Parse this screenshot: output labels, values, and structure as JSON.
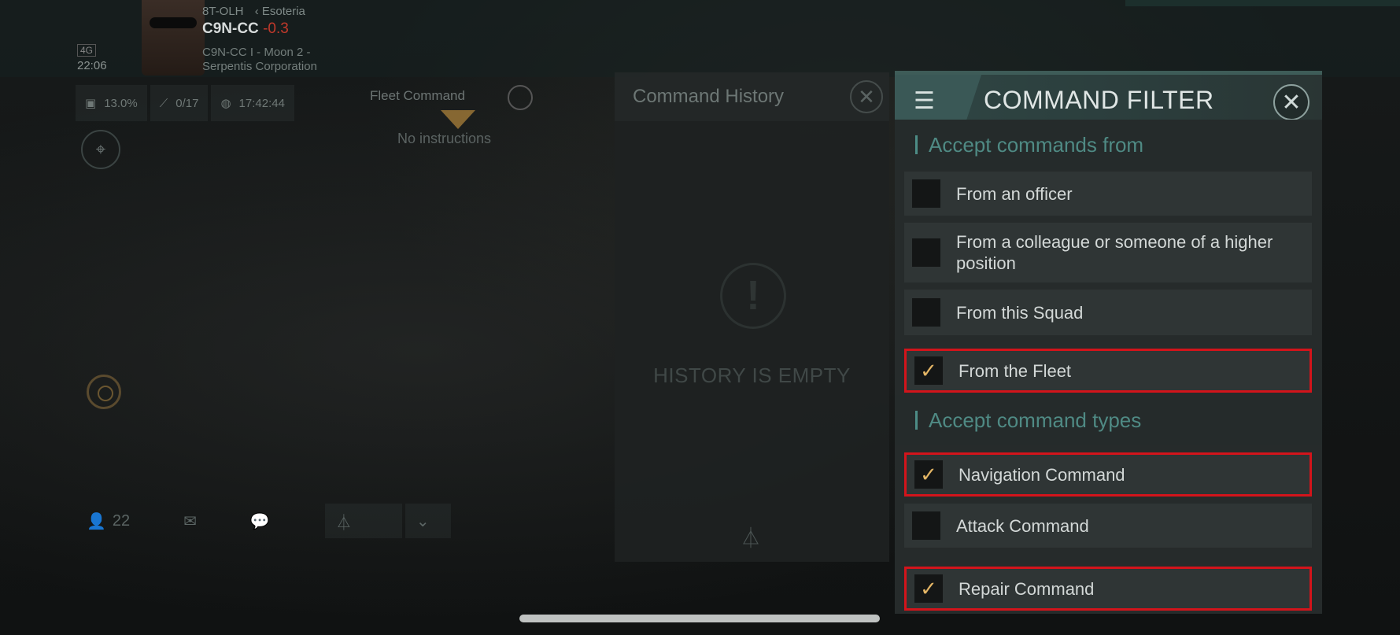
{
  "hud": {
    "pilot_region": "8T-OLH",
    "faction": "Esoteria",
    "system": "C9N-CC",
    "security": "-0.3",
    "location_line1": "C9N-CC I - Moon 2 -",
    "location_line2": "Serpentis Corporation",
    "signal": "4G",
    "clock": "22:06",
    "stats": [
      {
        "icon": "cargo-icon",
        "value": "13.0%"
      },
      {
        "icon": "chart-icon",
        "value": "0/17"
      },
      {
        "icon": "planet-icon",
        "value": "17:42:44"
      }
    ],
    "fleet_command_label": "Fleet Command",
    "no_instructions": "No instructions",
    "bottom": {
      "members": "22"
    }
  },
  "history": {
    "title": "Command History",
    "empty_text": "HISTORY IS EMPTY"
  },
  "filter": {
    "title": "COMMAND FILTER",
    "sections": [
      {
        "title": "Accept commands from"
      },
      {
        "title": "Accept command types"
      }
    ],
    "options": [
      {
        "label": "From an officer",
        "checked": false
      },
      {
        "label": "From a colleague or someone of a higher position",
        "checked": false
      },
      {
        "label": "From this Squad",
        "checked": false
      },
      {
        "label": "From the Fleet",
        "checked": true
      },
      {
        "label": "Navigation Command",
        "checked": true
      },
      {
        "label": "Attack Command",
        "checked": false
      },
      {
        "label": "Repair Command",
        "checked": true
      }
    ],
    "accent_color": "#4f8a84",
    "check_color": "#e3b565",
    "highlight_color": "#d3141b"
  }
}
